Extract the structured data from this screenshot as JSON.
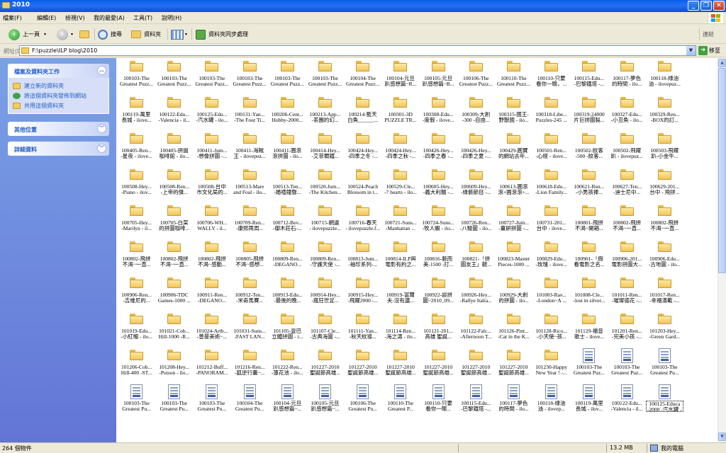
{
  "window": {
    "title": "2010"
  },
  "menu": [
    "檔案(F)",
    "編輯(E)",
    "檢視(V)",
    "我的最愛(A)",
    "工具(T)",
    "說明(H)"
  ],
  "toolbar": {
    "back": "上一頁",
    "search": "搜尋",
    "folders": "資料夾",
    "sync": "資料夾同步處理",
    "links": "連結"
  },
  "address": {
    "label": "網址(D)",
    "path": "F:\\puzzle\\ILP blog\\2010",
    "go": "移至"
  },
  "sidebar": {
    "tasks": {
      "title": "檔案及資料夾工作",
      "items": [
        "建立新的資料夾",
        "將這個資料夾發佈到網站",
        "共用這個資料夾"
      ]
    },
    "other": {
      "title": "其他位置"
    },
    "details": {
      "title": "詳細資料"
    }
  },
  "files": [
    {
      "kind": "folder",
      "l1": "100103-The",
      "l2": "Greatest Puzz..."
    },
    {
      "kind": "folder",
      "l1": "100103-The",
      "l2": "Greatest Puzz..."
    },
    {
      "kind": "folder",
      "l1": "100103-The",
      "l2": "Greatest Puzz..."
    },
    {
      "kind": "folder",
      "l1": "100103-The",
      "l2": "Greatest Puzz..."
    },
    {
      "kind": "folder",
      "l1": "100103-The",
      "l2": "Greatest Puzz..."
    },
    {
      "kind": "folder",
      "l1": "100103-The",
      "l2": "Greatest Puzz..."
    },
    {
      "kind": "folder",
      "l1": "100104-The",
      "l2": "Greatest Puzz..."
    },
    {
      "kind": "folder",
      "l1": "100104-元旦",
      "l2": "趴感想篇~R..."
    },
    {
      "kind": "folder",
      "l1": "100105-元旦",
      "l2": "趴感想篇~B..."
    },
    {
      "kind": "folder",
      "l1": "100106-The",
      "l2": "Greatest Puzz..."
    },
    {
      "kind": "folder",
      "l1": "100110-The",
      "l2": "Greatest Puzz..."
    },
    {
      "kind": "folder",
      "l1": "100110-只要",
      "l2": "看你一眼，..."
    },
    {
      "kind": "folder",
      "l1": "100115-Edu...",
      "l2": "-巴黎鐵塔 -..."
    },
    {
      "kind": "folder",
      "l1": "100117-夢色",
      "l2": "的時間 - ilo..."
    },
    {
      "kind": "folder",
      "l1": "100118-綠油",
      "l2": "油 - ilovepuz..."
    },
    {
      "kind": "folder",
      "l1": "100119-萬里",
      "l2": "長城 - ilove..."
    },
    {
      "kind": "folder",
      "l1": "100122-Edu...",
      "l2": "-Valencia - il..."
    },
    {
      "kind": "folder",
      "l1": "100125-Edu...",
      "l2": "-汽水罐 - ilo..."
    },
    {
      "kind": "folder",
      "l1": "100131-Yan...",
      "l2": "-The Four Ti..."
    },
    {
      "kind": "folder",
      "l1": "100206-Cent...",
      "l2": "Hobby-2000..."
    },
    {
      "kind": "folder",
      "l1": "100213-App...",
      "l2": "-茶園的幻..."
    },
    {
      "kind": "folder",
      "l1": "100214-藍天",
      "l2": "白魚______..."
    },
    {
      "kind": "folder",
      "l1": "100301-3D",
      "l2": "PUZZLE TR..."
    },
    {
      "kind": "folder",
      "l1": "100308-Edu...",
      "l2": "-度假 - ilove..."
    },
    {
      "kind": "folder",
      "l1": "100309-大創",
      "l2": "-300 -自由..."
    },
    {
      "kind": "folder",
      "l1": "100315-國王-",
      "l2": "野獸國 - ilo..."
    },
    {
      "kind": "folder",
      "l1": "100318-Libe...",
      "l2": "Puzzles-245 ..."
    },
    {
      "kind": "folder",
      "l1": "100319-24000",
      "l2": "片巨拼圖製..."
    },
    {
      "kind": "folder",
      "l1": "100327-Edu...",
      "l2": "-小丑魚 - ilo..."
    },
    {
      "kind": "folder",
      "l1": "100329-Ren...",
      "l2": "-BOX的訂..."
    },
    {
      "kind": "folder",
      "l1": "100405-Ren...",
      "l2": "-星夜 - ilove..."
    },
    {
      "kind": "folder",
      "l1": "100405-拼圖",
      "l2": "咖啡館 - ilo..."
    },
    {
      "kind": "folder",
      "l1": "100411-Jum...",
      "l2": "-想像拼圖 -..."
    },
    {
      "kind": "folder",
      "l1": "100411-海賊",
      "l2": "王 - ilovepuz..."
    },
    {
      "kind": "folder",
      "l1": "100411-圓滾",
      "l2": "滾拼圖 - ilo..."
    },
    {
      "kind": "folder",
      "l1": "100414-Hey...",
      "l2": "-艾菲爾鐵..."
    },
    {
      "kind": "folder",
      "l1": "100424-Hey...",
      "l2": "-四季之冬 -..."
    },
    {
      "kind": "folder",
      "l1": "100424-Hey...",
      "l2": "-四季之秋 -..."
    },
    {
      "kind": "folder",
      "l1": "100426-Hey...",
      "l2": "-四季之春 -..."
    },
    {
      "kind": "folder",
      "l1": "100426-Hey...",
      "l2": "-四季之夏 -..."
    },
    {
      "kind": "folder",
      "l1": "100429-圓寶",
      "l2": "的網站去年..."
    },
    {
      "kind": "folder",
      "l1": "100501-Ren...",
      "l2": "-心經 - ilove..."
    },
    {
      "kind": "folder",
      "l1": "100502-紋客",
      "l2": "-500 -紋客..."
    },
    {
      "kind": "folder",
      "l1": "100502-飛躍",
      "l2": "趴 - ilovepuz..."
    },
    {
      "kind": "folder",
      "l1": "100503-飛躍",
      "l2": "趴-小金牛..."
    },
    {
      "kind": "folder",
      "l1": "100508-Hey...",
      "l2": "-Piano - ilov..."
    },
    {
      "kind": "folder",
      "l1": "100508-Ren...",
      "l2": "-上帝的傑..."
    },
    {
      "kind": "folder",
      "l1": "100508-台中",
      "l2": "市文化局的..."
    },
    {
      "kind": "folder",
      "l1": "100513-Mare",
      "l2": "and Foal - ilo..."
    },
    {
      "kind": "folder",
      "l1": "100513-Ten...",
      "l2": "-婚禮鐘聲..."
    },
    {
      "kind": "folder",
      "l1": "100520-Jum...",
      "l2": "-The Kitchen..."
    },
    {
      "kind": "folder",
      "l1": "100524-Peach",
      "l2": "Blossom in t..."
    },
    {
      "kind": "folder",
      "l1": "100529-Cle...",
      "l2": "-7 hearts - ilo..."
    },
    {
      "kind": "folder",
      "l1": "100605-Hey...",
      "l2": "-義大利麵 -..."
    },
    {
      "kind": "folder",
      "l1": "100609-Hey...",
      "l2": "-綠藝節目 -..."
    },
    {
      "kind": "folder",
      "l1": "100613-圓滾",
      "l2": "滾+圓滾滾+..."
    },
    {
      "kind": "folder",
      "l1": "100618-Edu...",
      "l2": "-Lion Family..."
    },
    {
      "kind": "folder",
      "l1": "100621-Ren...",
      "l2": "-小男孩捧..."
    },
    {
      "kind": "folder",
      "l1": "100627-Ten...",
      "l2": "-迪士尼中..."
    },
    {
      "kind": "folder",
      "l1": "100629-201...",
      "l2": "台中 - 飛拼..."
    },
    {
      "kind": "folder",
      "l1": "100705-Hey...",
      "l2": "-Marilyn - il..."
    },
    {
      "kind": "folder",
      "l1": "100705-白菜",
      "l2": "的拼圖咖啡..."
    },
    {
      "kind": "folder",
      "l1": "100706-WH...",
      "l2": "WALLY - il..."
    },
    {
      "kind": "folder",
      "l1": "100709-Ren...",
      "l2": "-康熙兩周..."
    },
    {
      "kind": "folder",
      "l1": "100712-Bev...",
      "l2": "-御木莊石-..."
    },
    {
      "kind": "folder",
      "l1": "100715-網邊",
      "l2": "- ilovepuzzle..."
    },
    {
      "kind": "folder",
      "l1": "100716-春天",
      "l2": "- ilovepuzzle.f..."
    },
    {
      "kind": "folder",
      "l1": "100721-Suns...",
      "l2": "-Manhattan ..."
    },
    {
      "kind": "folder",
      "l1": "100724-Suns...",
      "l2": "-牧人蝦 - ilo..."
    },
    {
      "kind": "folder",
      "l1": "100726-Ren...",
      "l2": "-八駿圖 - ilo..."
    },
    {
      "kind": "folder",
      "l1": "100727-Jum...",
      "l2": "-薑餅拼圖 -..."
    },
    {
      "kind": "folder",
      "l1": "100731-201...",
      "l2": "台中 - ilove..."
    },
    {
      "kind": "folder",
      "l1": "100801-飛拼",
      "l2": "不渴~開箱..."
    },
    {
      "kind": "folder",
      "l1": "100802-飛拼",
      "l2": "不渴~一直..."
    },
    {
      "kind": "folder",
      "l1": "100802-飛拼",
      "l2": "不渴~一直..."
    },
    {
      "kind": "folder",
      "l1": "100802-飛拼",
      "l2": "不渴~一直..."
    },
    {
      "kind": "folder",
      "l1": "100802-飛拼",
      "l2": "不渴~一直..."
    },
    {
      "kind": "folder",
      "l1": "100802-飛拼",
      "l2": "不渴~感動..."
    },
    {
      "kind": "folder",
      "l1": "100805-飛拼",
      "l2": "不渴~感想..."
    },
    {
      "kind": "folder",
      "l1": "100809-Ren...",
      "l2": "-DEGANO..."
    },
    {
      "kind": "folder",
      "l1": "100809-Ren...",
      "l2": "-守護天使 -..."
    },
    {
      "kind": "folder",
      "l1": "100813-Jum...",
      "l2": "-袖珍系列-..."
    },
    {
      "kind": "folder",
      "l1": "100814-ILP與",
      "l2": "電影有約之..."
    },
    {
      "kind": "folder",
      "l1": "100816-藝而",
      "l2": "美-1500 -打..."
    },
    {
      "kind": "folder",
      "l1": "100821-「拼",
      "l2": "圖友王」觀..."
    },
    {
      "kind": "folder",
      "l1": "100823-Master",
      "l2": "Pieces-1000 ..."
    },
    {
      "kind": "folder",
      "l1": "100829-Edu...",
      "l2": "-玫瑰 - ilove..."
    },
    {
      "kind": "folder",
      "l1": "100901-「假",
      "l2": "看電影之名..."
    },
    {
      "kind": "folder",
      "l1": "100906-201...",
      "l2": "電影拼圖大..."
    },
    {
      "kind": "folder",
      "l1": "100906-Edu...",
      "l2": "-古地圖 - ilo..."
    },
    {
      "kind": "folder",
      "l1": "100906-Ren...",
      "l2": "-吉維尼的..."
    },
    {
      "kind": "folder",
      "l1": "100906-TDC",
      "l2": "Games-1000 ..."
    },
    {
      "kind": "folder",
      "l1": "100911-Ren...",
      "l2": "-DEGANO..."
    },
    {
      "kind": "folder",
      "l1": "100912-Ten...",
      "l2": "-米奇馬賽..."
    },
    {
      "kind": "folder",
      "l1": "100913-Edu...",
      "l2": "-最後的晚..."
    },
    {
      "kind": "folder",
      "l1": "100914-Hey...",
      "l2": "-瘋狂世足..."
    },
    {
      "kind": "folder",
      "l1": "100915-Hey...",
      "l2": "-飛躍2000 -..."
    },
    {
      "kind": "folder",
      "l1": "100919-富爾",
      "l2": "夫-沒有遺..."
    },
    {
      "kind": "folder",
      "l1": "100922-談拼",
      "l2": "圖~2010_09..."
    },
    {
      "kind": "folder",
      "l1": "100926-Hey...",
      "l2": "-Rallye Italia..."
    },
    {
      "kind": "folder",
      "l1": "100929-大創",
      "l2": "的拼圖 - ilo..."
    },
    {
      "kind": "folder",
      "l1": "101003-Rav...",
      "l2": "-London~A ..."
    },
    {
      "kind": "folder",
      "l1": "101008-Cle...",
      "l2": "-lost in silver..."
    },
    {
      "kind": "folder",
      "l1": "101011-Ren...",
      "l2": "-璀璨德花 -..."
    },
    {
      "kind": "folder",
      "l1": "101017-Ren...",
      "l2": "-幸福滿載 -..."
    },
    {
      "kind": "folder",
      "l1": "101019-Edu...",
      "l2": "-小紅帽 - ilo..."
    },
    {
      "kind": "folder",
      "l1": "101021-Cob...",
      "l2": "Hill-1000 -R..."
    },
    {
      "kind": "folder",
      "l1": "101024-Artb...",
      "l2": "-普曼美術~..."
    },
    {
      "kind": "folder",
      "l1": "101031-Suns...",
      "l2": "-FAST LAN..."
    },
    {
      "kind": "folder",
      "l1": "101105-壹巴",
      "l2": "立體拼圖 - i..."
    },
    {
      "kind": "folder",
      "l1": "101107-Cle...",
      "l2": "-古典海圖 -..."
    },
    {
      "kind": "folder",
      "l1": "101111-Yan...",
      "l2": "-秋天紋導..."
    },
    {
      "kind": "folder",
      "l1": "101114-Ren...",
      "l2": "-海之濤 - ilo..."
    },
    {
      "kind": "folder",
      "l1": "101121-201...",
      "l2": "高雄 聖誕..."
    },
    {
      "kind": "folder",
      "l1": "101122-Falc...",
      "l2": "-Afternoon T..."
    },
    {
      "kind": "folder",
      "l1": "101126-Pint...",
      "l2": "-Cat in the K..."
    },
    {
      "kind": "folder",
      "l1": "101128-Rico...",
      "l2": "-小天使~孩..."
    },
    {
      "kind": "folder",
      "l1": "101129-福音",
      "l2": "歌士 - ilove..."
    },
    {
      "kind": "folder",
      "l1": "101201-Ren...",
      "l2": "-完美小孩 -..."
    },
    {
      "kind": "folder",
      "l1": "101203-Hey...",
      "l2": "-Green Gard..."
    },
    {
      "kind": "folder",
      "l1": "101206-Cob...",
      "l2": "Hill-400 -ST..."
    },
    {
      "kind": "folder",
      "l1": "101208-Hey...",
      "l2": "-Poison - ilo..."
    },
    {
      "kind": "folder",
      "l1": "101212-Buff...",
      "l2": "-PANORAM..."
    },
    {
      "kind": "folder",
      "l1": "101216-Ren...",
      "l2": "-狐逆行囊~..."
    },
    {
      "kind": "folder",
      "l1": "101222-Ren...",
      "l2": "-蓮花池 - ilo..."
    },
    {
      "kind": "folder",
      "l1": "101227-2010",
      "l2": "聖誕節高雄..."
    },
    {
      "kind": "folder",
      "l1": "101227-2010",
      "l2": "聖誕節高雄..."
    },
    {
      "kind": "folder",
      "l1": "101227-2010",
      "l2": "聖誕節高雄..."
    },
    {
      "kind": "folder",
      "l1": "101227-2010",
      "l2": "聖誕節高雄..."
    },
    {
      "kind": "folder",
      "l1": "101227-2010",
      "l2": "聖誕節高雄..."
    },
    {
      "kind": "folder",
      "l1": "101227-2010",
      "l2": "聖誕節高雄..."
    },
    {
      "kind": "folder",
      "l1": "101230-Happy",
      "l2": "New Year ! -..."
    },
    {
      "kind": "doc",
      "l1": "100103-The",
      "l2": "Greatest Puz..."
    },
    {
      "kind": "doc",
      "l1": "100103-The",
      "l2": "Greatest Puz..."
    },
    {
      "kind": "doc",
      "l1": "100103-The",
      "l2": "Greatest Pu..."
    },
    {
      "kind": "doc",
      "l1": "100103-The",
      "l2": "Greatest Pu..."
    },
    {
      "kind": "doc",
      "l1": "100103-The",
      "l2": "Greatest Pu..."
    },
    {
      "kind": "doc",
      "l1": "100103-The",
      "l2": "Greatest Pu..."
    },
    {
      "kind": "doc",
      "l1": "100104-The",
      "l2": "Greatest Pu..."
    },
    {
      "kind": "doc",
      "l1": "100104-元旦",
      "l2": "趴感想篇~..."
    },
    {
      "kind": "doc",
      "l1": "100105-元旦",
      "l2": "趴感想篇~..."
    },
    {
      "kind": "doc",
      "l1": "100106-The",
      "l2": "Greatest Pu..."
    },
    {
      "kind": "doc",
      "l1": "100110-The",
      "l2": "Greatest P..."
    },
    {
      "kind": "doc",
      "l1": "100110-只要",
      "l2": "看你一眼..."
    },
    {
      "kind": "doc",
      "l1": "100115-Edu...",
      "l2": "-巴黎鐵塔 -..."
    },
    {
      "kind": "doc",
      "l1": "100117-夢色",
      "l2": "的時間 - ilo..."
    },
    {
      "kind": "doc",
      "l1": "100118-綠油",
      "l2": "油 - ilovep..."
    },
    {
      "kind": "doc",
      "l1": "100119-萬里",
      "l2": "長城 - ilov..."
    },
    {
      "kind": "doc",
      "l1": "100122-Edu...",
      "l2": "-Valencia - il..."
    },
    {
      "kind": "doc",
      "l1": "100125-Educa",
      "l2": "-2000 -汽水罐 - ilovepuzzle",
      "selected": true
    }
  ],
  "status": {
    "count": "264 個物件",
    "size": "13.2 MB",
    "location": "我的電腦"
  }
}
